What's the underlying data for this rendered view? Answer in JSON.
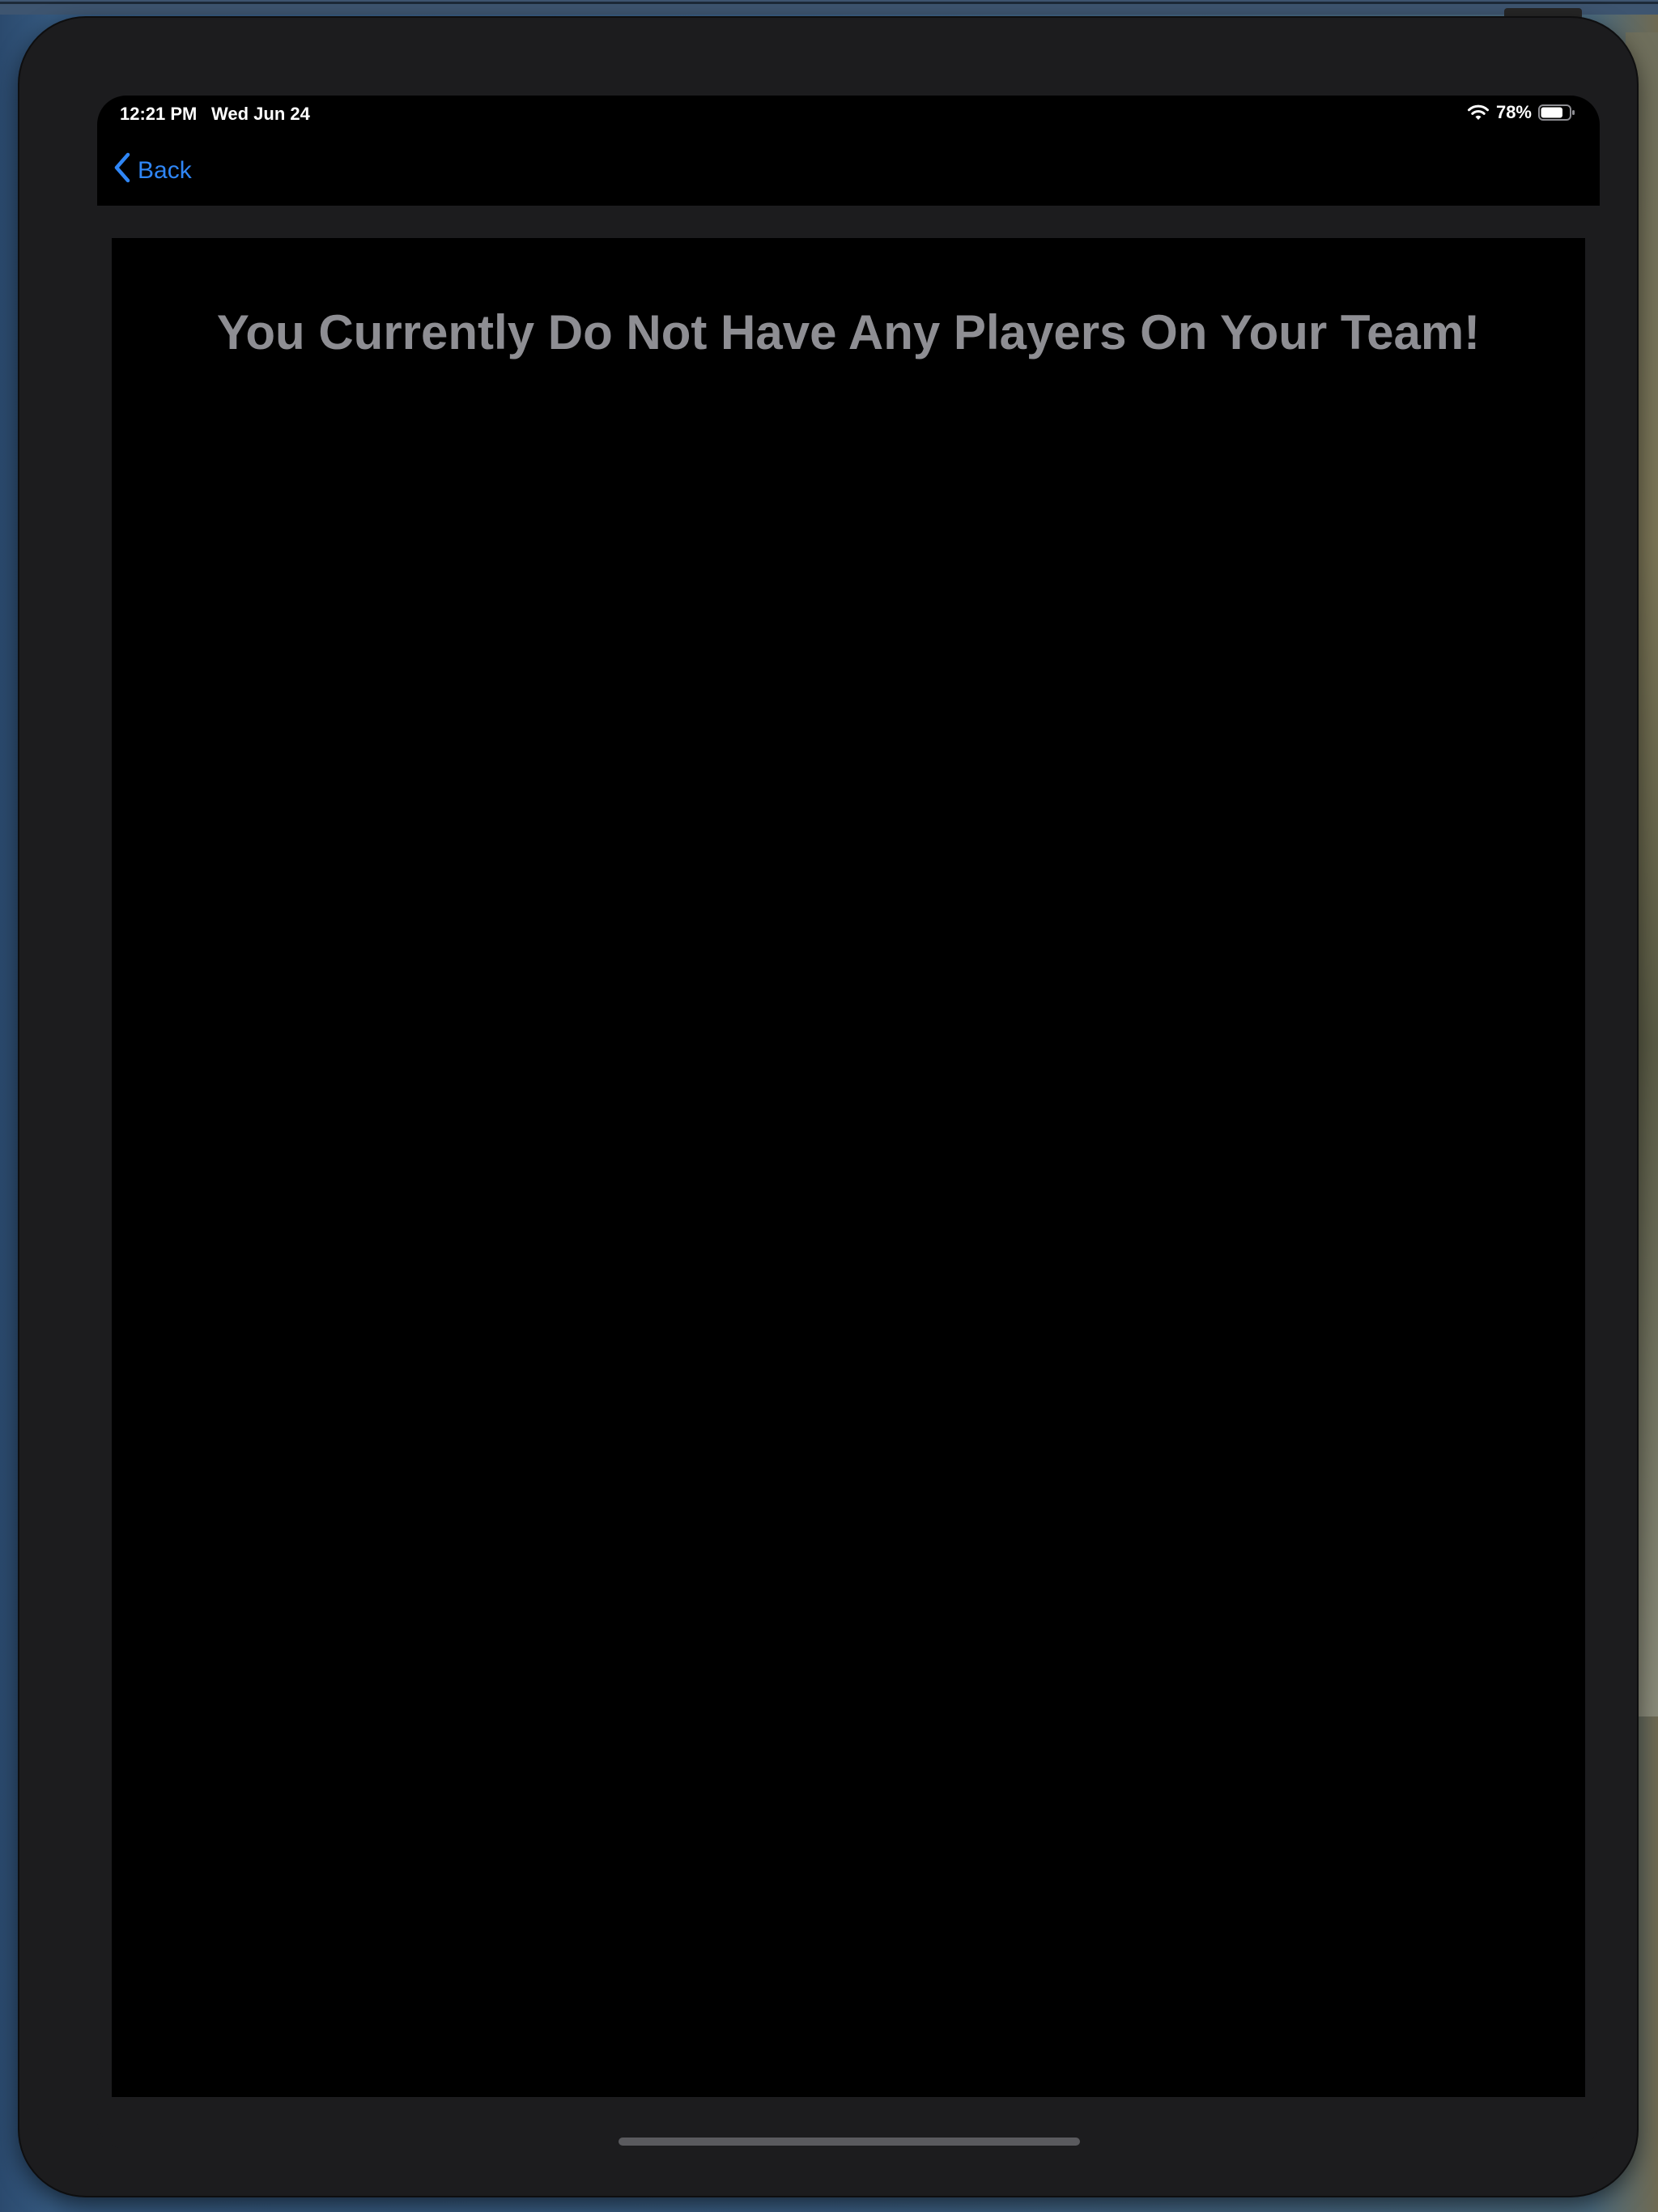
{
  "status_bar": {
    "time": "12:21 PM",
    "date": "Wed Jun 24",
    "battery_percent": "78%",
    "battery_level": 0.78,
    "wifi_icon": "wifi-icon",
    "battery_icon": "battery-icon"
  },
  "nav": {
    "back_label": "Back",
    "back_icon": "chevron-left-icon"
  },
  "main": {
    "empty_message": "You Currently Do Not Have Any Players On Your Team!"
  },
  "colors": {
    "accent": "#2f86f6",
    "message_text": "#8e8e93",
    "background": "#000000",
    "frame": "#1c1c1e"
  }
}
